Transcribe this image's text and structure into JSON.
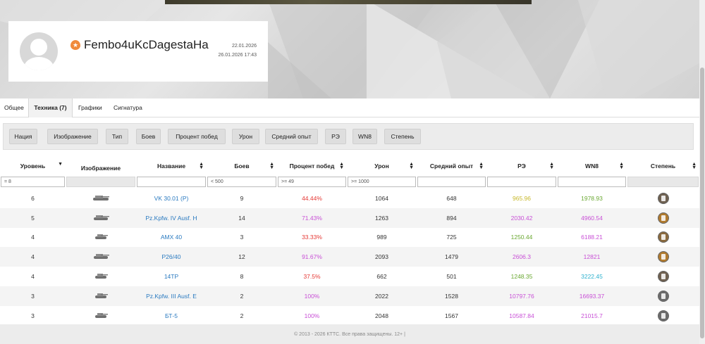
{
  "profile": {
    "nickname": "Fembo4uKcDagestaHa",
    "date_registered": "22.01.2026",
    "date_last_battle": "26.01.2026 17:43",
    "badge_color": "#f08a3c"
  },
  "tabs": [
    {
      "label": "Общее",
      "active": false
    },
    {
      "label": "Техника (7)",
      "active": true
    },
    {
      "label": "Графики",
      "active": false
    },
    {
      "label": "Сигнатура",
      "active": false
    }
  ],
  "column_toggles": [
    "Нация",
    "Изображение",
    "Тип",
    "Боев",
    "Процент побед",
    "Урон",
    "Средний опыт",
    "РЭ",
    "WN8",
    "Степень"
  ],
  "table": {
    "headers": [
      "Уровень",
      "Изображение",
      "Название",
      "Боев",
      "Процент побед",
      "Урон",
      "Средний опыт",
      "РЭ",
      "WN8",
      "Степень"
    ],
    "filters": [
      "= 8",
      "",
      "",
      "< 500",
      ">= 49",
      ">= 1000",
      "",
      "",
      "",
      ""
    ],
    "rows": [
      {
        "level": "6",
        "name": "VK 30.01 (P)",
        "battles": "9",
        "winrate": "44.44%",
        "winrate_color": "#e53935",
        "damage": "1064",
        "avg_xp": "648",
        "re": "965.96",
        "re_color": "#c7b82b",
        "wn8": "1978.93",
        "wn8_color": "#6aa832",
        "mastery": "class-3",
        "tank_icon": "heavy-tank-icon"
      },
      {
        "level": "5",
        "name": "Pz.Kpfw. IV Ausf. H",
        "battles": "14",
        "winrate": "71.43%",
        "winrate_color": "#c84fd6",
        "damage": "1263",
        "avg_xp": "894",
        "re": "2030.42",
        "re_color": "#c84fd6",
        "wn8": "4960.54",
        "wn8_color": "#c84fd6",
        "mastery": "class-1",
        "tank_icon": "medium-tank-icon"
      },
      {
        "level": "4",
        "name": "AMX 40",
        "battles": "3",
        "winrate": "33.33%",
        "winrate_color": "#e53935",
        "damage": "989",
        "avg_xp": "725",
        "re": "1250.44",
        "re_color": "#6aa832",
        "wn8": "6188.21",
        "wn8_color": "#c84fd6",
        "mastery": "class-2",
        "tank_icon": "light-tank-icon"
      },
      {
        "level": "4",
        "name": "P26/40",
        "battles": "12",
        "winrate": "91.67%",
        "winrate_color": "#c84fd6",
        "damage": "2093",
        "avg_xp": "1479",
        "re": "2606.3",
        "re_color": "#c84fd6",
        "wn8": "12821",
        "wn8_color": "#c84fd6",
        "mastery": "class-1",
        "tank_icon": "medium-tank-icon"
      },
      {
        "level": "4",
        "name": "14TP",
        "battles": "8",
        "winrate": "37.5%",
        "winrate_color": "#e53935",
        "damage": "662",
        "avg_xp": "501",
        "re": "1248.35",
        "re_color": "#6aa832",
        "wn8": "3222.45",
        "wn8_color": "#2fb2cf",
        "mastery": "class-3",
        "tank_icon": "light-tank-icon"
      },
      {
        "level": "3",
        "name": "Pz.Kpfw. III Ausf. E",
        "battles": "2",
        "winrate": "100%",
        "winrate_color": "#c84fd6",
        "damage": "2022",
        "avg_xp": "1528",
        "re": "10797.76",
        "re_color": "#c84fd6",
        "wn8": "16693.37",
        "wn8_color": "#c84fd6",
        "mastery": "master",
        "tank_icon": "light-tank-icon"
      },
      {
        "level": "3",
        "name": "БТ-5",
        "battles": "2",
        "winrate": "100%",
        "winrate_color": "#c84fd6",
        "damage": "2048",
        "avg_xp": "1567",
        "re": "10587.84",
        "re_color": "#c84fd6",
        "wn8": "21015.7",
        "wn8_color": "#c84fd6",
        "mastery": "master",
        "tank_icon": "light-tank-icon"
      }
    ]
  },
  "footer": {
    "text": "© 2013 - 2026 КТТС. Все права защищены. 12+  |"
  }
}
